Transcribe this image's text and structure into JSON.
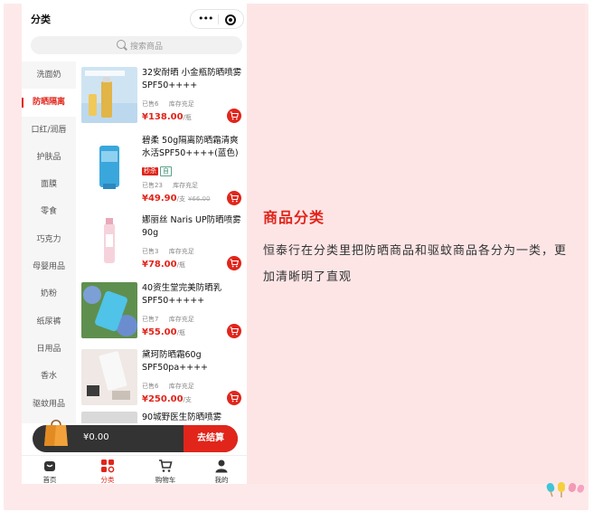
{
  "header": {
    "title": "分类"
  },
  "search": {
    "placeholder": "搜索商品"
  },
  "sidebar": {
    "items": [
      {
        "label": "洗面奶",
        "active": false
      },
      {
        "label": "防晒隔离",
        "active": true
      },
      {
        "label": "口红/润唇",
        "active": false
      },
      {
        "label": "护肤品",
        "active": false
      },
      {
        "label": "面膜",
        "active": false
      },
      {
        "label": "零食",
        "active": false
      },
      {
        "label": "巧克力",
        "active": false
      },
      {
        "label": "母婴用品",
        "active": false
      },
      {
        "label": "奶粉",
        "active": false
      },
      {
        "label": "纸尿裤",
        "active": false
      },
      {
        "label": "日用品",
        "active": false
      },
      {
        "label": "香水",
        "active": false
      },
      {
        "label": "驱蚊用品",
        "active": false
      }
    ]
  },
  "products": [
    {
      "name": "32安耐晒 小金瓶防晒喷雾SPF50++++",
      "sold": "已售6",
      "stock": "库存充足",
      "price": "¥138.00",
      "unit": "/瓶",
      "orig_price": "",
      "tags": []
    },
    {
      "name": "碧柔 50g隔离防晒霜清爽水活SPF50++++(蓝色)",
      "sold": "已售23",
      "stock": "库存充足",
      "price": "¥49.90",
      "unit": "/支",
      "orig_price": "¥66.00",
      "tags": [
        "秒杀",
        "自"
      ]
    },
    {
      "name": "娜丽丝 Naris UP防晒喷雾90g",
      "sold": "已售3",
      "stock": "库存充足",
      "price": "¥78.00",
      "unit": "/瓶",
      "orig_price": "",
      "tags": []
    },
    {
      "name": "40资生堂完美防晒乳SPF50+++++",
      "sold": "已售7",
      "stock": "库存充足",
      "price": "¥55.00",
      "unit": "/瓶",
      "orig_price": "",
      "tags": []
    },
    {
      "name": "黛珂防晒霜60g SPF50pa++++",
      "sold": "已售6",
      "stock": "库存充足",
      "price": "¥250.00",
      "unit": "/支",
      "orig_price": "",
      "tags": []
    },
    {
      "name": "90城野医生防晒喷雾",
      "sold": "",
      "stock": "",
      "price": "",
      "unit": "",
      "orig_price": "",
      "tags": []
    }
  ],
  "cart": {
    "total": "¥0.00",
    "checkout_label": "去结算"
  },
  "tabbar": {
    "items": [
      {
        "label": "首页",
        "icon": "home-icon",
        "active": false
      },
      {
        "label": "分类",
        "icon": "category-icon",
        "active": true
      },
      {
        "label": "购物车",
        "icon": "cart-icon",
        "active": false
      },
      {
        "label": "我的",
        "icon": "user-icon",
        "active": false
      }
    ]
  },
  "feature": {
    "title": "商品分类",
    "description": "恒泰行在分类里把防晒商品和驱蚊商品各分为一类，更加清晰明了直观"
  },
  "colors": {
    "accent": "#e1251b",
    "panel_bg": "#fde5e6",
    "cart_bar": "#333333"
  }
}
